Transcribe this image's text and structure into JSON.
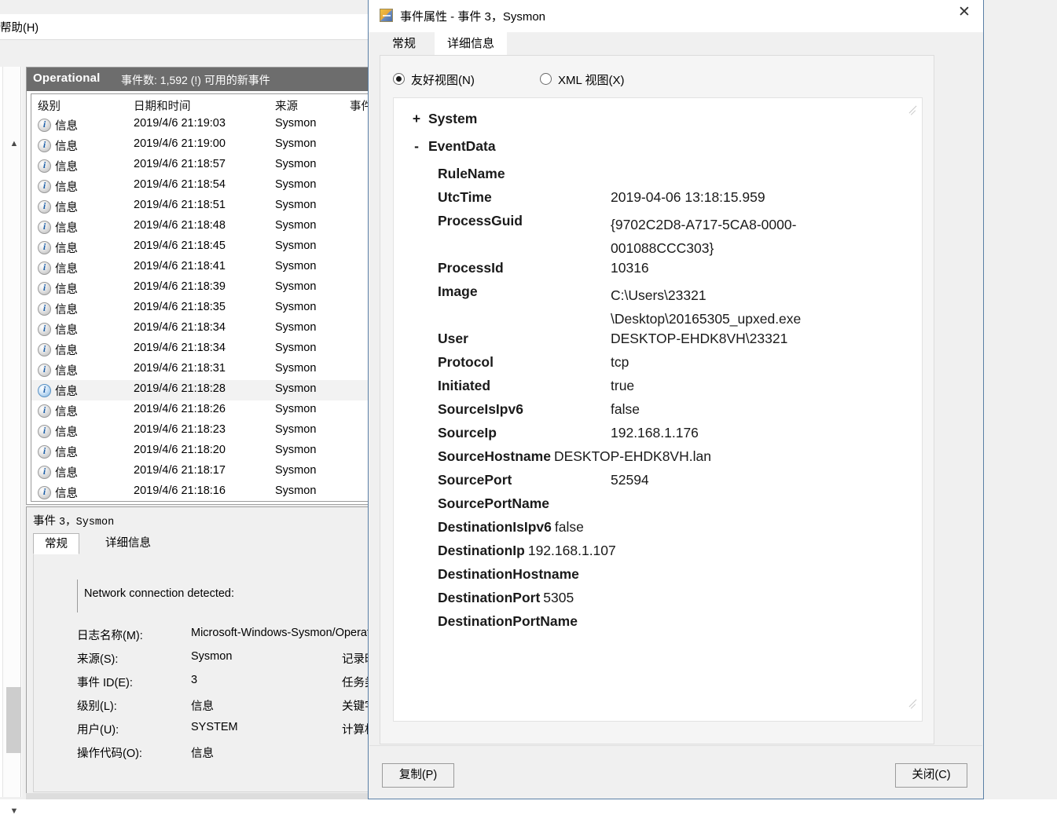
{
  "app": {
    "menu": {
      "help": "帮助(H)"
    },
    "log_header": {
      "name": "Operational",
      "count_text": "事件数: 1,592 (!) 可用的新事件"
    },
    "grid": {
      "columns": [
        "级别",
        "日期和时间",
        "来源",
        "事件"
      ],
      "rows": [
        {
          "level": "信息",
          "datetime": "2019/4/6 21:19:03",
          "source": "Sysmon"
        },
        {
          "level": "信息",
          "datetime": "2019/4/6 21:19:00",
          "source": "Sysmon"
        },
        {
          "level": "信息",
          "datetime": "2019/4/6 21:18:57",
          "source": "Sysmon"
        },
        {
          "level": "信息",
          "datetime": "2019/4/6 21:18:54",
          "source": "Sysmon"
        },
        {
          "level": "信息",
          "datetime": "2019/4/6 21:18:51",
          "source": "Sysmon"
        },
        {
          "level": "信息",
          "datetime": "2019/4/6 21:18:48",
          "source": "Sysmon"
        },
        {
          "level": "信息",
          "datetime": "2019/4/6 21:18:45",
          "source": "Sysmon"
        },
        {
          "level": "信息",
          "datetime": "2019/4/6 21:18:41",
          "source": "Sysmon"
        },
        {
          "level": "信息",
          "datetime": "2019/4/6 21:18:39",
          "source": "Sysmon"
        },
        {
          "level": "信息",
          "datetime": "2019/4/6 21:18:35",
          "source": "Sysmon"
        },
        {
          "level": "信息",
          "datetime": "2019/4/6 21:18:34",
          "source": "Sysmon"
        },
        {
          "level": "信息",
          "datetime": "2019/4/6 21:18:34",
          "source": "Sysmon"
        },
        {
          "level": "信息",
          "datetime": "2019/4/6 21:18:31",
          "source": "Sysmon"
        },
        {
          "level": "信息",
          "datetime": "2019/4/6 21:18:28",
          "source": "Sysmon"
        },
        {
          "level": "信息",
          "datetime": "2019/4/6 21:18:26",
          "source": "Sysmon"
        },
        {
          "level": "信息",
          "datetime": "2019/4/6 21:18:23",
          "source": "Sysmon"
        },
        {
          "level": "信息",
          "datetime": "2019/4/6 21:18:20",
          "source": "Sysmon"
        },
        {
          "level": "信息",
          "datetime": "2019/4/6 21:18:17",
          "source": "Sysmon"
        },
        {
          "level": "信息",
          "datetime": "2019/4/6 21:18:16",
          "source": "Sysmon"
        }
      ],
      "selected_index": 13
    },
    "detail_pane": {
      "title_prefix": "事件",
      "title_rest": "3，Sysmon",
      "tabs": [
        "常规",
        "详细信息"
      ],
      "active_tab": "常规",
      "message": "Network connection detected:",
      "fields_left": [
        {
          "label": "日志名称(M):",
          "value": "Microsoft-Windows-Sysmon/Operation"
        },
        {
          "label": "来源(S):",
          "value": "Sysmon"
        },
        {
          "label": "事件 ID(E):",
          "value": "3"
        },
        {
          "label": "级别(L):",
          "value": "信息"
        },
        {
          "label": "用户(U):",
          "value": "SYSTEM"
        },
        {
          "label": "操作代码(O):",
          "value": "信息"
        }
      ],
      "fields_right": [
        "记录时间(D",
        "任务类别(\\",
        "关键字(K):",
        "计算机(R):"
      ]
    }
  },
  "dialog": {
    "title": "事件属性 - 事件 3，Sysmon",
    "close_icon": "✕",
    "tabs": [
      "常规",
      "详细信息"
    ],
    "active_tab": "详细信息",
    "view_options": [
      {
        "label": "友好视图(N)",
        "selected": true
      },
      {
        "label": "XML 视图(X)",
        "selected": false
      }
    ],
    "nodes": [
      {
        "sign": "+",
        "name": "System"
      },
      {
        "sign": "-",
        "name": "EventData"
      }
    ],
    "event_data": [
      {
        "key": "RuleName",
        "value": ""
      },
      {
        "key": "UtcTime",
        "value": "2019-04-06 13:18:15.959"
      },
      {
        "key": "ProcessGuid",
        "value": "{9702C2D8-A717-5CA8-0000-001088CCC303}"
      },
      {
        "key": "ProcessId",
        "value": "10316"
      },
      {
        "key": "Image",
        "value": "C:\\Users\\23321\\Desktop\\20165305_upxed.exe"
      },
      {
        "key": "User",
        "value": "DESKTOP-EHDK8VH\\23321"
      },
      {
        "key": "Protocol",
        "value": "tcp"
      },
      {
        "key": "Initiated",
        "value": "true"
      },
      {
        "key": "SourceIsIpv6",
        "value": "false"
      },
      {
        "key": "SourceIp",
        "value": "192.168.1.176"
      },
      {
        "key": "SourceHostname",
        "value": "DESKTOP-EHDK8VH.lan"
      },
      {
        "key": "SourcePort",
        "value": "52594"
      },
      {
        "key": "SourcePortName",
        "value": ""
      },
      {
        "key": "DestinationIsIpv6",
        "value": "false"
      },
      {
        "key": "DestinationIp",
        "value": "192.168.1.107"
      },
      {
        "key": "DestinationHostname",
        "value": ""
      },
      {
        "key": "DestinationPort",
        "value": "5305"
      },
      {
        "key": "DestinationPortName",
        "value": ""
      }
    ],
    "nav": {
      "up_icon": "⬆",
      "down_icon": "⬇"
    },
    "buttons": {
      "copy": "复制(P)",
      "close": "关闭(C)"
    }
  },
  "colors": {
    "header_bar": "#6d6d6d",
    "dialog_border": "#5a7fa6",
    "link": "#1a3fb0",
    "selection": "#f2f2f2"
  }
}
